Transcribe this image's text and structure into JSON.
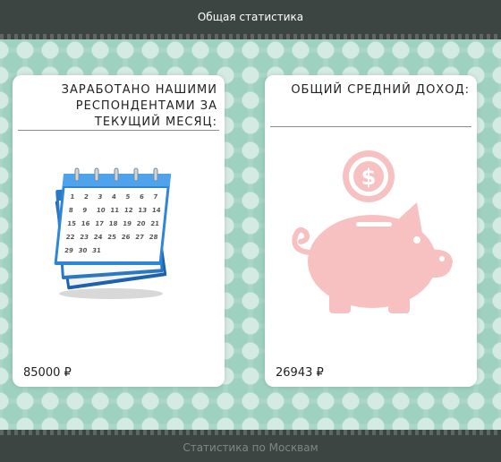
{
  "header": {
    "title": "Общая статистика"
  },
  "cards": [
    {
      "title": "ЗАРАБОТАНО НАШИМИ РЕСПОНДЕНТАМИ ЗА ТЕКУЩИЙ МЕСЯЦ:",
      "value": "85000 ₽",
      "icon": "calendar-icon"
    },
    {
      "title": "ОБЩИЙ СРЕДНИЙ ДОХОД:",
      "value": "26943 ₽",
      "icon": "piggy-bank-icon"
    }
  ],
  "calendar_days": [
    "1",
    "2",
    "3",
    "4",
    "5",
    "6",
    "7",
    "8",
    "9",
    "10",
    "11",
    "12",
    "13",
    "14",
    "15",
    "16",
    "17",
    "18",
    "19",
    "20",
    "21",
    "22",
    "23",
    "24",
    "25",
    "26",
    "27",
    "28",
    "29",
    "30",
    "31"
  ],
  "footer": {
    "label": "Статистика по Москвам"
  },
  "colors": {
    "bar": "#3c4541",
    "pattern": "#a9d6c8",
    "piggy": "#f8c1c1"
  }
}
